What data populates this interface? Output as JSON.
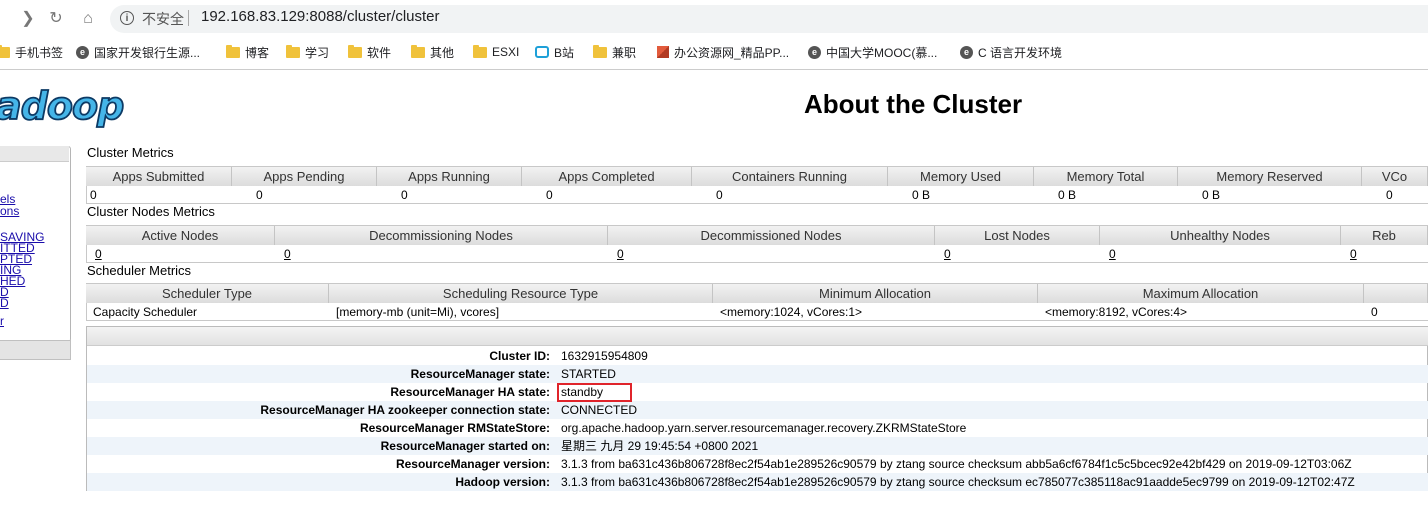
{
  "browser": {
    "insecure_label": "不安全",
    "url": "192.168.83.129:8088/cluster/cluster",
    "bookmarks": [
      {
        "label": "手机书签",
        "icon": "folder-icon"
      },
      {
        "label": "国家开发银行生源...",
        "icon": "site-icon"
      },
      {
        "label": "博客",
        "icon": "folder-icon"
      },
      {
        "label": "学习",
        "icon": "folder-icon"
      },
      {
        "label": "软件",
        "icon": "folder-icon"
      },
      {
        "label": "其他",
        "icon": "folder-icon"
      },
      {
        "label": "ESXI",
        "icon": "folder-icon"
      },
      {
        "label": "B站",
        "icon": "bilibili-icon"
      },
      {
        "label": "兼职",
        "icon": "folder-icon"
      },
      {
        "label": "办公资源网_精品PP...",
        "icon": "cube-icon"
      },
      {
        "label": "中国大学MOOC(慕...",
        "icon": "site-icon"
      },
      {
        "label": "C 语言开发环境",
        "icon": "site-icon"
      }
    ]
  },
  "header": {
    "logo_text": "hadoop",
    "title": "About the Cluster"
  },
  "nav": {
    "links": [
      "els",
      "ons",
      "SAVING",
      "ITTED",
      "PTED",
      "ING",
      "HED",
      "D",
      "D",
      "r"
    ]
  },
  "cluster_metrics": {
    "title": "Cluster Metrics",
    "headers": [
      "Apps Submitted",
      "Apps Pending",
      "Apps Running",
      "Apps Completed",
      "Containers Running",
      "Memory Used",
      "Memory Total",
      "Memory Reserved",
      "VCo"
    ],
    "values": [
      "0",
      "0",
      "0",
      "0",
      "0",
      "0 B",
      "0 B",
      "0 B",
      "0"
    ]
  },
  "cluster_nodes_metrics": {
    "title": "Cluster Nodes Metrics",
    "headers": [
      "Active Nodes",
      "Decommissioning Nodes",
      "Decommissioned Nodes",
      "Lost Nodes",
      "Unhealthy Nodes",
      "Reb"
    ],
    "values": [
      "0",
      "0",
      "0",
      "0",
      "0",
      "0"
    ]
  },
  "scheduler_metrics": {
    "title": "Scheduler Metrics",
    "headers": [
      "Scheduler Type",
      "Scheduling Resource Type",
      "Minimum Allocation",
      "Maximum Allocation",
      ""
    ],
    "values": [
      "Capacity Scheduler",
      "[memory-mb (unit=Mi), vcores]",
      "<memory:1024, vCores:1>",
      "<memory:8192, vCores:4>",
      "0"
    ]
  },
  "cluster_info": [
    {
      "key": "Cluster ID:",
      "value": "1632915954809"
    },
    {
      "key": "ResourceManager state:",
      "value": "STARTED"
    },
    {
      "key": "ResourceManager HA state:",
      "value": "standby"
    },
    {
      "key": "ResourceManager HA zookeeper connection state:",
      "value": "CONNECTED"
    },
    {
      "key": "ResourceManager RMStateStore:",
      "value": "org.apache.hadoop.yarn.server.resourcemanager.recovery.ZKRMStateStore"
    },
    {
      "key": "ResourceManager started on:",
      "value": "星期三 九月 29 19:45:54 +0800 2021"
    },
    {
      "key": "ResourceManager version:",
      "value": "3.1.3 from ba631c436b806728f8ec2f54ab1e289526c90579 by ztang source checksum abb5a6cf6784f1c5c5bcec92e42bf429 on 2019-09-12T03:06Z"
    },
    {
      "key": "Hadoop version:",
      "value": "3.1.3 from ba631c436b806728f8ec2f54ab1e289526c90579 by ztang source checksum ec785077c385118ac91aadde5ec9799 on 2019-09-12T02:47Z"
    }
  ]
}
